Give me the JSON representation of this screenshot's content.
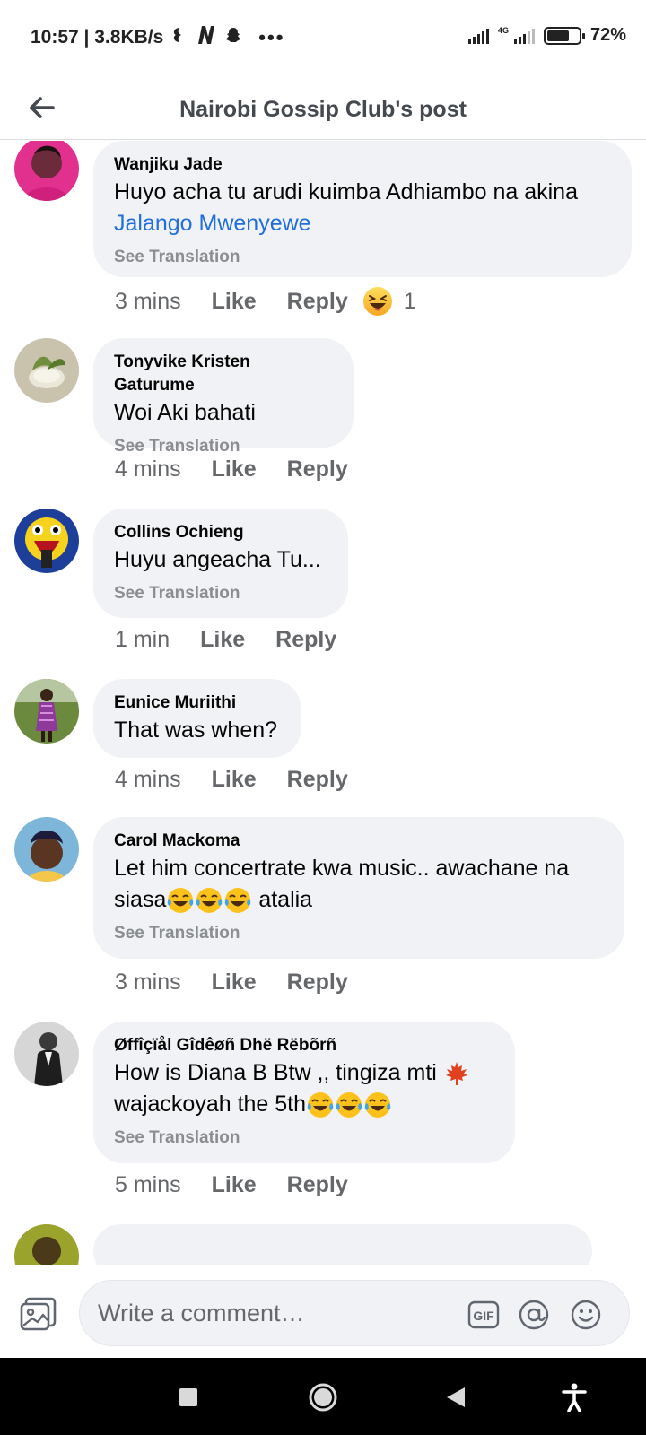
{
  "status_bar": {
    "time_speed": "10:57 | 3.8KB/s",
    "net_tag": "4G",
    "battery_text": "72%",
    "battery_level": 0.72
  },
  "header": {
    "title": "Nairobi Gossip Club's post",
    "back_icon": "arrow-left-icon"
  },
  "comments": [
    {
      "author": "Wanjiku Jade",
      "text": "Huyo acha tu arudi kuimba Adhiambo na akina",
      "link": "Jalango Mwenyewe",
      "translation": "See Translation",
      "time": "3 mins",
      "like": "Like",
      "reply": "Reply",
      "reaction_count": "1"
    },
    {
      "author": "Tonyvike Kristen Gaturume",
      "text": "Woi Aki bahati",
      "translation": "See Translation",
      "time": "4 mins",
      "like": "Like",
      "reply": "Reply"
    },
    {
      "author": "Collins Ochieng",
      "text": "Huyu angeacha Tu...",
      "translation": "See Translation",
      "time": "1 min",
      "like": "Like",
      "reply": "Reply"
    },
    {
      "author": "Eunice Muriithi",
      "text": "That was when?",
      "time": "4 mins",
      "like": "Like",
      "reply": "Reply"
    },
    {
      "author": "Carol Mackoma",
      "text_line1": "Let him concertrate kwa music.. awachane na",
      "text_line2_pre": "siasa",
      "text_line2_post": " atalia",
      "translation": "See Translation",
      "time": "3 mins",
      "like": "Like",
      "reply": "Reply"
    },
    {
      "author": "Øffîçïål Gîdêøñ Dhë Rëbõrñ",
      "text_line1": "How is Diana B Btw ,, tingiza mti",
      "text_line2": "wajackoyah the 5th",
      "translation": "See Translation",
      "time": "5 mins",
      "like": "Like",
      "reply": "Reply"
    }
  ],
  "composer": {
    "placeholder": "Write a comment…",
    "gif_label": "GIF"
  }
}
